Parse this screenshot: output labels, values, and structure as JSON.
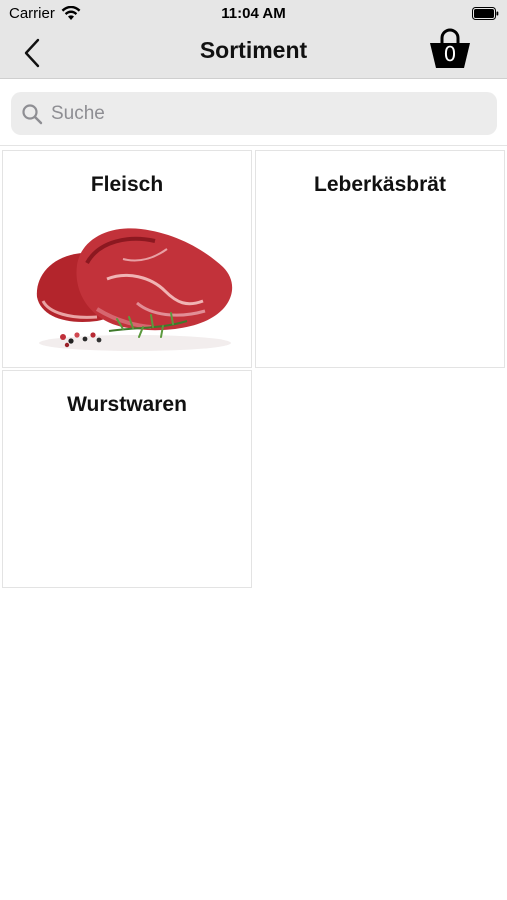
{
  "status_bar": {
    "carrier": "Carrier",
    "time": "11:04 AM"
  },
  "nav": {
    "title": "Sortiment",
    "cart_count": "0"
  },
  "search": {
    "placeholder": "Suche"
  },
  "categories": [
    {
      "label": "Fleisch",
      "image": "raw-beef-steak"
    },
    {
      "label": "Leberkäsbrät"
    },
    {
      "label": "Wurstwaren"
    }
  ],
  "colors": {
    "bar_background": "#e6e6e6",
    "search_background": "#ececec",
    "tile_border": "#e3e3e3"
  }
}
